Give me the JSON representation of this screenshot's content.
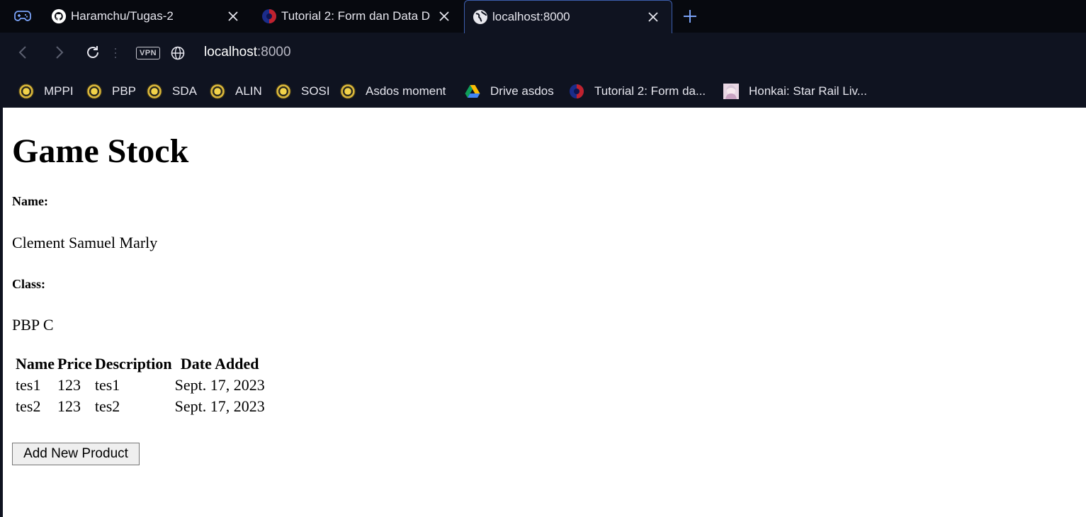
{
  "browser": {
    "tabs": [
      {
        "title": "Haramchu/Tugas-2",
        "icon": "github-icon",
        "active": false
      },
      {
        "title": "Tutorial 2: Form dan Data D",
        "icon": "pbp-logo-icon",
        "active": false
      },
      {
        "title": "localhost:8000",
        "icon": "globe-icon",
        "active": true
      }
    ],
    "vpn_label": "VPN",
    "url_host": "localhost",
    "url_port": ":8000",
    "bookmarks": [
      {
        "label": "MPPI",
        "icon": "ui-seal-icon"
      },
      {
        "label": "PBP",
        "icon": "ui-seal-icon"
      },
      {
        "label": "SDA",
        "icon": "ui-seal-icon"
      },
      {
        "label": "ALIN",
        "icon": "ui-seal-icon"
      },
      {
        "label": "SOSI",
        "icon": "ui-seal-icon"
      },
      {
        "label": "Asdos moment",
        "icon": "ui-seal-icon"
      },
      {
        "label": "Drive asdos",
        "icon": "google-drive-icon"
      },
      {
        "label": "Tutorial 2: Form da...",
        "icon": "pbp-logo-icon"
      },
      {
        "label": "Honkai: Star Rail Liv...",
        "icon": "anime-avatar-icon"
      }
    ],
    "accent": "#3d5fae"
  },
  "page": {
    "title": "Game Stock",
    "name_label": "Name:",
    "name_value": "Clement Samuel Marly",
    "class_label": "Class:",
    "class_value": "PBP C",
    "table": {
      "headers": [
        "Name",
        "Price",
        "Description",
        "Date Added"
      ],
      "rows": [
        [
          "tes1",
          "123",
          "tes1",
          "Sept. 17, 2023"
        ],
        [
          "tes2",
          "123",
          "tes2",
          "Sept. 17, 2023"
        ]
      ]
    },
    "add_button": "Add New Product"
  }
}
